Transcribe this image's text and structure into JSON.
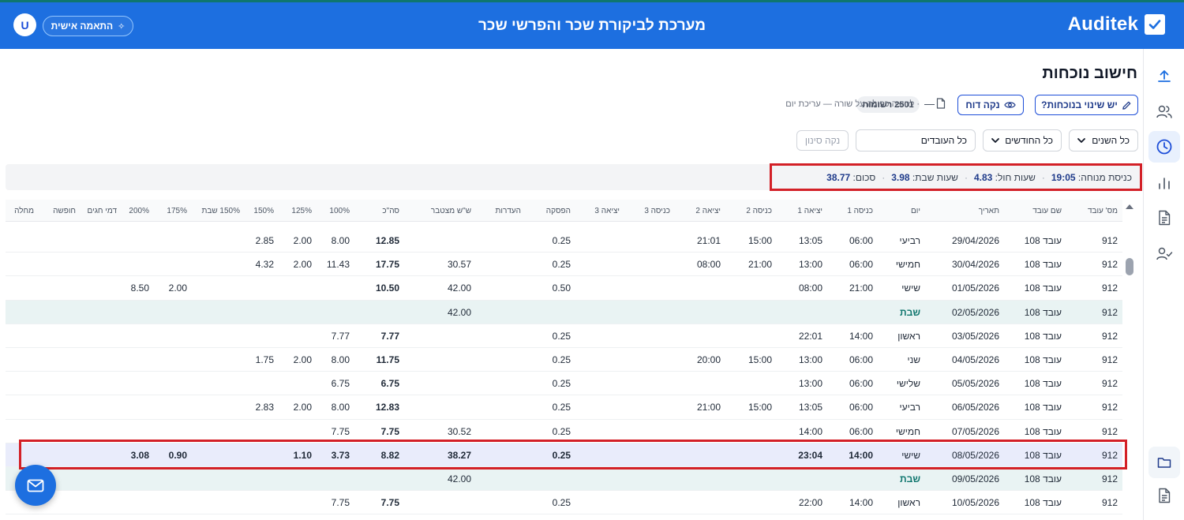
{
  "header": {
    "brand": "Auditek",
    "title": "מערכת לביקורת שכר והפרשי שכר",
    "personal_label": "התאמה אישית",
    "avatar_letter": "U"
  },
  "page": {
    "title": "חישוב נוכחות",
    "attendance_change_label": "יש שינוי בנוכחות?",
    "clean_report_label": "נקה דוח",
    "records_badge": "2501 רשומות",
    "dash": "—",
    "hint": "· לחיצה כפולה על שורה — עריכת יום"
  },
  "filters": {
    "years": "כל השנים",
    "months": "כל החודשים",
    "employees": "כל העובדים",
    "clear": "נקה סינון"
  },
  "summary": {
    "entry_label": "כניסת מנוחה:",
    "entry_value": "19:05",
    "holiday_label": "שעות חול:",
    "holiday_value": "4.83",
    "shabbat_label": "שעות שבת:",
    "shabbat_value": "3.98",
    "total_label": "סכום:",
    "total_value": "38.77",
    "sep": "·"
  },
  "table": {
    "headers": [
      "מס' עובד",
      "שם עובד",
      "תאריך",
      "יום",
      "כניסה 1",
      "יציאה 1",
      "כניסה 2",
      "יציאה 2",
      "כניסה 3",
      "יציאה 3",
      "הפסקה",
      "העדרות",
      "ש\"ש מצטבר",
      "סה\"כ",
      "100%",
      "125%",
      "150%",
      "150% שבת",
      "175%",
      "200%",
      "דמי חגים",
      "חופשה",
      "מחלה"
    ],
    "rows": [
      {
        "type": "normal",
        "cells": [
          "912",
          "עובד 108",
          "29/04/2026",
          "רביעי",
          "06:00",
          "13:05",
          "15:00",
          "21:01",
          "",
          "",
          "0.25",
          "",
          "",
          "12.85",
          "8.00",
          "2.00",
          "2.85",
          "",
          "",
          "",
          "",
          "",
          ""
        ]
      },
      {
        "type": "normal",
        "cells": [
          "912",
          "עובד 108",
          "30/04/2026",
          "חמישי",
          "06:00",
          "13:00",
          "21:00",
          "08:00",
          "",
          "",
          "0.25",
          "",
          "30.57",
          "17.75",
          "11.43",
          "2.00",
          "4.32",
          "",
          "",
          "",
          "",
          "",
          ""
        ]
      },
      {
        "type": "normal",
        "cells": [
          "912",
          "עובד 108",
          "01/05/2026",
          "שישי",
          "21:00",
          "08:00",
          "",
          "",
          "",
          "",
          "0.50",
          "",
          "42.00",
          "10.50",
          "",
          "",
          "",
          "",
          "2.00",
          "8.50",
          "",
          "",
          ""
        ]
      },
      {
        "type": "shabbat",
        "cells": [
          "912",
          "עובד 108",
          "02/05/2026",
          "שבת",
          "",
          "",
          "",
          "",
          "",
          "",
          "",
          "",
          "42.00",
          "",
          "",
          "",
          "",
          "",
          "",
          "",
          "",
          "",
          ""
        ]
      },
      {
        "type": "normal",
        "cells": [
          "912",
          "עובד 108",
          "03/05/2026",
          "ראשון",
          "14:00",
          "22:01",
          "",
          "",
          "",
          "",
          "0.25",
          "",
          "",
          "7.77",
          "7.77",
          "",
          "",
          "",
          "",
          "",
          "",
          "",
          ""
        ]
      },
      {
        "type": "normal",
        "cells": [
          "912",
          "עובד 108",
          "04/05/2026",
          "שני",
          "06:00",
          "13:00",
          "15:00",
          "20:00",
          "",
          "",
          "0.25",
          "",
          "",
          "11.75",
          "8.00",
          "2.00",
          "1.75",
          "",
          "",
          "",
          "",
          "",
          ""
        ]
      },
      {
        "type": "normal",
        "cells": [
          "912",
          "עובד 108",
          "05/05/2026",
          "שלישי",
          "06:00",
          "13:00",
          "",
          "",
          "",
          "",
          "0.25",
          "",
          "",
          "6.75",
          "6.75",
          "",
          "",
          "",
          "",
          "",
          "",
          "",
          ""
        ]
      },
      {
        "type": "normal",
        "cells": [
          "912",
          "עובד 108",
          "06/05/2026",
          "רביעי",
          "06:00",
          "13:05",
          "15:00",
          "21:00",
          "",
          "",
          "0.25",
          "",
          "",
          "12.83",
          "8.00",
          "2.00",
          "2.83",
          "",
          "",
          "",
          "",
          "",
          ""
        ]
      },
      {
        "type": "normal",
        "cells": [
          "912",
          "עובד 108",
          "07/05/2026",
          "חמישי",
          "06:00",
          "14:00",
          "",
          "",
          "",
          "",
          "0.25",
          "",
          "30.52",
          "7.75",
          "7.75",
          "",
          "",
          "",
          "",
          "",
          "",
          "",
          ""
        ]
      },
      {
        "type": "selected",
        "cells": [
          "912",
          "עובד 108",
          "08/05/2026",
          "שישי",
          "14:00",
          "23:04",
          "",
          "",
          "",
          "",
          "0.25",
          "",
          "38.27",
          "8.82",
          "3.73",
          "1.10",
          "",
          "",
          "0.90",
          "3.08",
          "",
          "",
          ""
        ]
      },
      {
        "type": "shabbat",
        "cells": [
          "912",
          "עובד 108",
          "09/05/2026",
          "שבת",
          "",
          "",
          "",
          "",
          "",
          "",
          "",
          "",
          "42.00",
          "",
          "",
          "",
          "",
          "",
          "",
          "",
          "",
          "",
          ""
        ]
      },
      {
        "type": "normal",
        "cells": [
          "912",
          "עובד 108",
          "10/05/2026",
          "ראשון",
          "14:00",
          "22:00",
          "",
          "",
          "",
          "",
          "0.25",
          "",
          "",
          "7.75",
          "7.75",
          "",
          "",
          "",
          "",
          "",
          "",
          "",
          ""
        ]
      }
    ]
  },
  "icons": {
    "sidebar": [
      "upload-icon",
      "users-icon",
      "clock-icon",
      "bar-chart-icon",
      "document-icon",
      "user-check-icon",
      "folder-icon",
      "file-text-icon"
    ],
    "accent": "#1d6fe0",
    "highlight": "#d32027"
  }
}
